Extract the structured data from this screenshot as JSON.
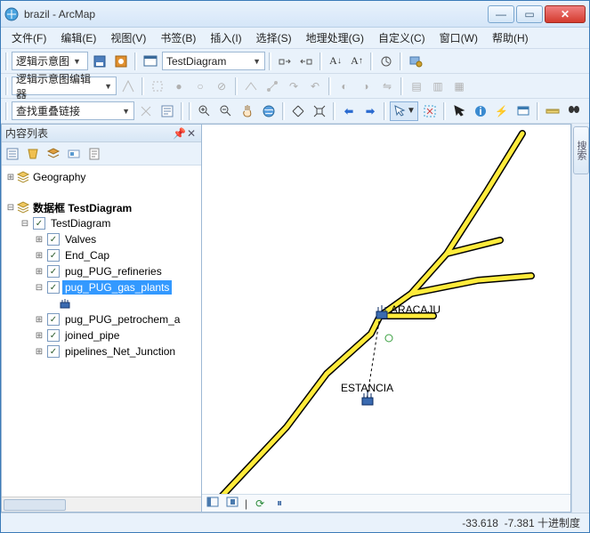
{
  "window": {
    "doc_title": "brazil",
    "app_name": "ArcMap"
  },
  "win_buttons": {
    "min": "—",
    "max": "▭",
    "close": "✕"
  },
  "menu": {
    "file": "文件(F)",
    "edit": "编辑(E)",
    "view": "视图(V)",
    "bookmarks": "书签(B)",
    "insert": "插入(I)",
    "selection": "选择(S)",
    "geoprocessing": "地理处理(G)",
    "customize": "自定义(C)",
    "windows": "窗口(W)",
    "help": "帮助(H)"
  },
  "toolbar1": {
    "dropdown1": "逻辑示意图",
    "combo_layer": "TestDiagram"
  },
  "toolbar2": {
    "dropdown1": "逻辑示意图编辑器"
  },
  "toolbar3": {
    "dropdown1": "查找重叠链接"
  },
  "toc": {
    "title": "内容列表",
    "root1": "Geography",
    "df_prefix": "数据框",
    "df_name": "TestDiagram",
    "layers": [
      "TestDiagram",
      "Valves",
      "End_Cap",
      "pug_PUG_refineries",
      "pug_PUG_gas_plants",
      "pug_PUG_petrochem_a",
      "joined_pipe",
      "pipelines_Net_Junction"
    ]
  },
  "map": {
    "label_aracaju": "ARACAJU",
    "label_estancia": "ESTANCIA",
    "nav_icons": {
      "prev": "|◀",
      "next": "▶|",
      "refresh": "⟳",
      "pause": "⏸"
    }
  },
  "sidebar_tab": "搜索",
  "status": {
    "x": "-33.618",
    "y": "-7.381",
    "units": "十进制度"
  }
}
